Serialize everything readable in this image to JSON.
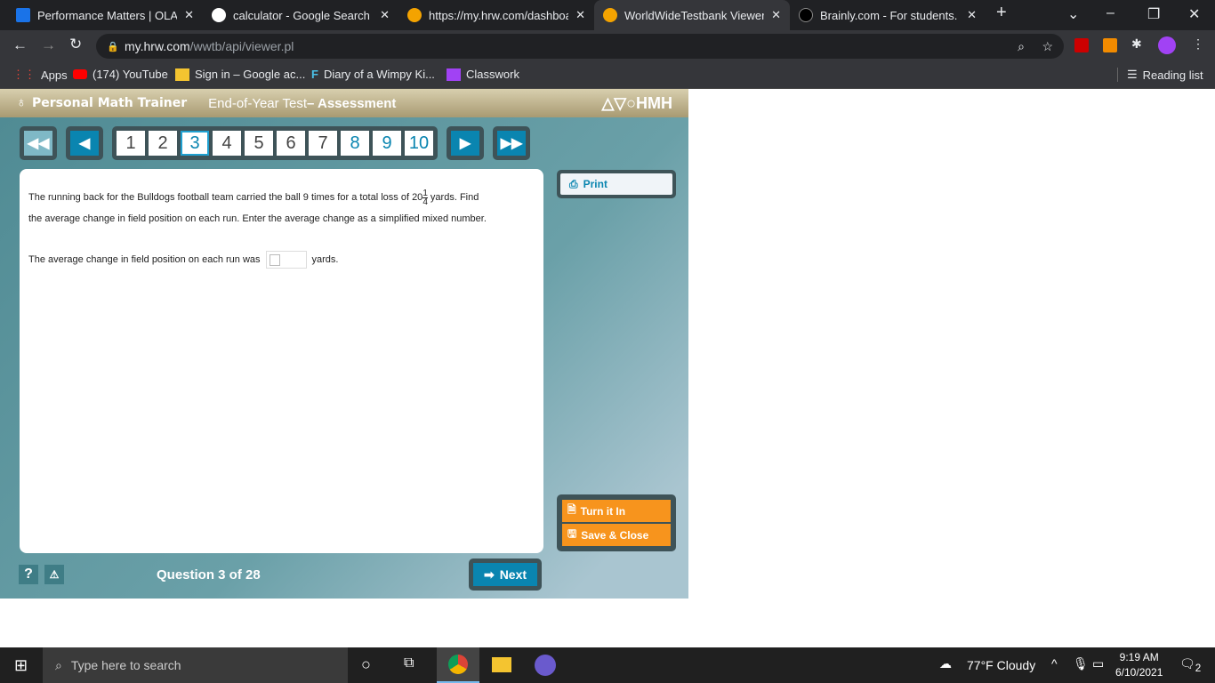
{
  "browser": {
    "tabs": [
      {
        "title": "Performance Matters | OLA",
        "color": "#1a73e8"
      },
      {
        "title": "calculator - Google Search",
        "color": "#4285f4"
      },
      {
        "title": "https://my.hrw.com/dashboard",
        "color": "#f4a300"
      },
      {
        "title": "WorldWideTestbank Viewer",
        "color": "#f4a300"
      },
      {
        "title": "Brainly.com - For students. By",
        "color": "#000000"
      }
    ],
    "url_domain": "my.hrw.com",
    "url_path": "/wwtb/api/viewer.pl",
    "bookmarks": [
      "Apps",
      "(174) YouTube",
      "Sign in – Google ac...",
      "Diary of a Wimpy Ki...",
      "Classwork"
    ],
    "reading_list": "Reading list"
  },
  "app": {
    "brand": "Personal Math Trainer",
    "test": "End-of-Year Test",
    "section": "– Assessment",
    "publisher": "HMH",
    "pages": [
      "1",
      "2",
      "3",
      "4",
      "5",
      "6",
      "7",
      "8",
      "9",
      "10"
    ],
    "current_page": "3",
    "question_p1": "The running back for the Bulldogs football team carried the ball 9 times for a total loss of 20",
    "frac_num": "1",
    "frac_den": "4",
    "question_p1_end": " yards. Find",
    "question_p2": "the average change in field position on each run. Enter the average change as a simplified mixed number.",
    "answer_prefix": "The average change in field position on each run was",
    "answer_value": "",
    "answer_suffix": "yards.",
    "print": "Print",
    "turn_in": "Turn it In",
    "save_close": "Save & Close",
    "help": "?",
    "warn": "!",
    "progress": "Question 3 of 28",
    "next": "Next"
  },
  "taskbar": {
    "search_placeholder": "Type here to search",
    "weather": "77°F  Cloudy",
    "time": "9:19 AM",
    "date": "6/10/2021",
    "notifications": "2"
  }
}
